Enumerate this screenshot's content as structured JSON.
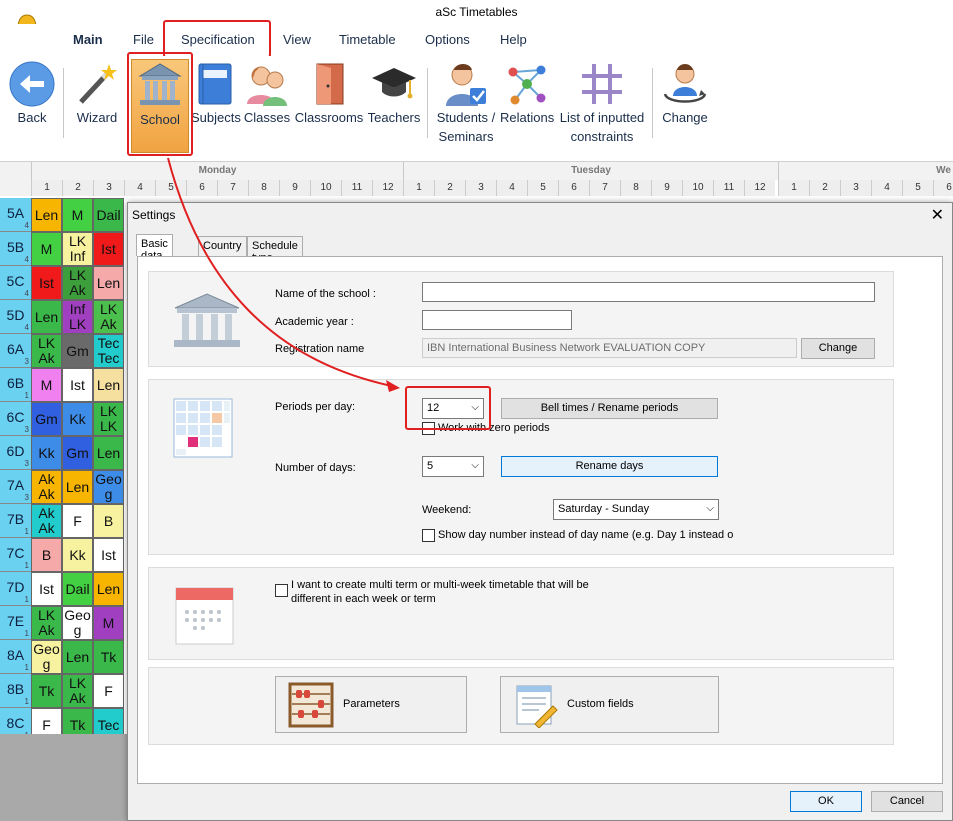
{
  "window": {
    "title": "aSc Timetables"
  },
  "menu": {
    "items": [
      "Main",
      "File",
      "Specification",
      "View",
      "Timetable",
      "Options",
      "Help"
    ]
  },
  "ribbon": {
    "back": "Back",
    "wizard": "Wizard",
    "school": "School",
    "subjects": "Subjects",
    "classes": "Classes",
    "classrooms": "Classrooms",
    "teachers": "Teachers",
    "students_l1": "Students /",
    "students_l2": "Seminars",
    "relations": "Relations",
    "constraints_l1": "List of inputted",
    "constraints_l2": "constraints",
    "change": "Change"
  },
  "grid": {
    "days": [
      "Monday",
      "Tuesday",
      "We"
    ],
    "periods": [
      "1",
      "2",
      "3",
      "4",
      "5",
      "6",
      "7",
      "8",
      "9",
      "10",
      "11",
      "12"
    ],
    "rows": [
      {
        "name": "5A",
        "sub": "4",
        "cells": [
          {
            "t": "Len",
            "c": "#f7b500"
          },
          {
            "t": "M",
            "c": "#43d143"
          },
          {
            "t": "Dail",
            "c": "#3bb84a"
          }
        ]
      },
      {
        "name": "5B",
        "sub": "4",
        "cells": [
          {
            "t": "M",
            "c": "#43d143"
          },
          {
            "t": "LK Inf",
            "c": "#f6f2a0"
          },
          {
            "t": "Ist",
            "c": "#f01a1a"
          }
        ]
      },
      {
        "name": "5C",
        "sub": "4",
        "cells": [
          {
            "t": "Ist",
            "c": "#f01a1a"
          },
          {
            "t": "LK Ak",
            "c": "#3c9f3c"
          },
          {
            "t": "Len",
            "c": "#f5a9a9"
          }
        ]
      },
      {
        "name": "5D",
        "sub": "4",
        "cells": [
          {
            "t": "Len",
            "c": "#3bb84a"
          },
          {
            "t": "Inf LK",
            "c": "#a040c0"
          },
          {
            "t": "LK Ak",
            "c": "#4cc04c"
          }
        ]
      },
      {
        "name": "6A",
        "sub": "3",
        "cells": [
          {
            "t": "LK Ak",
            "c": "#3bb84a"
          },
          {
            "t": "Gm",
            "c": "#6a6a6a"
          },
          {
            "t": "Tec Tec",
            "c": "#22cccc"
          }
        ]
      },
      {
        "name": "6B",
        "sub": "1",
        "cells": [
          {
            "t": "M",
            "c": "#f080f0"
          },
          {
            "t": "Ist",
            "c": "#ffffff"
          },
          {
            "t": "Len",
            "c": "#f5e0a0"
          }
        ]
      },
      {
        "name": "6C",
        "sub": "3",
        "cells": [
          {
            "t": "Gm",
            "c": "#3060e0"
          },
          {
            "t": "Kk",
            "c": "#3d8de8"
          },
          {
            "t": "LK LK",
            "c": "#3bb84a"
          }
        ]
      },
      {
        "name": "6D",
        "sub": "3",
        "cells": [
          {
            "t": "Kk",
            "c": "#3d8de8"
          },
          {
            "t": "Gm",
            "c": "#3060e0"
          },
          {
            "t": "Len",
            "c": "#3bb84a"
          }
        ]
      },
      {
        "name": "7A",
        "sub": "3",
        "cells": [
          {
            "t": "Ak Ak",
            "c": "#f7b500"
          },
          {
            "t": "Len",
            "c": "#f7b500"
          },
          {
            "t": "Geo g",
            "c": "#3d8de8"
          }
        ]
      },
      {
        "name": "7B",
        "sub": "1",
        "cells": [
          {
            "t": "Ak Ak",
            "c": "#22cccc"
          },
          {
            "t": "F",
            "c": "#ffffff"
          },
          {
            "t": "B",
            "c": "#f6f2a0"
          }
        ]
      },
      {
        "name": "7C",
        "sub": "1",
        "cells": [
          {
            "t": "B",
            "c": "#f5a9a9"
          },
          {
            "t": "Kk",
            "c": "#f6f2a0"
          },
          {
            "t": "Ist",
            "c": "#ffffff"
          }
        ]
      },
      {
        "name": "7D",
        "sub": "1",
        "cells": [
          {
            "t": "Ist",
            "c": "#ffffff"
          },
          {
            "t": "Dail",
            "c": "#43d143"
          },
          {
            "t": "Len",
            "c": "#f7b500"
          }
        ]
      },
      {
        "name": "7E",
        "sub": "1",
        "cells": [
          {
            "t": "LK Ak",
            "c": "#3bb84a"
          },
          {
            "t": "Geo g",
            "c": "#ffffff"
          },
          {
            "t": "M",
            "c": "#a040c0"
          }
        ]
      },
      {
        "name": "8A",
        "sub": "1",
        "cells": [
          {
            "t": "Geo g",
            "c": "#f6f2a0"
          },
          {
            "t": "Len",
            "c": "#3bb84a"
          },
          {
            "t": "Tk",
            "c": "#3bb84a"
          }
        ]
      },
      {
        "name": "8B",
        "sub": "1",
        "cells": [
          {
            "t": "Tk",
            "c": "#3bb84a"
          },
          {
            "t": "LK Ak",
            "c": "#3bb84a"
          },
          {
            "t": "F",
            "c": "#ffffff"
          }
        ]
      },
      {
        "name": "8C",
        "sub": "1",
        "cells": [
          {
            "t": "F",
            "c": "#ffffff"
          },
          {
            "t": "Tk",
            "c": "#3bb84a"
          },
          {
            "t": "Tec",
            "c": "#22cccc"
          }
        ]
      }
    ]
  },
  "dialog": {
    "title": "Settings",
    "close": "✕",
    "tabs": [
      "Basic data",
      "Country",
      "Schedule type"
    ],
    "name_label": "Name of the school :",
    "name_value": "",
    "year_label": "Academic year :",
    "year_value": "",
    "reg_label": "Registration name",
    "reg_value": "IBN International Business Network EVALUATION COPY",
    "change_btn": "Change",
    "periods_label": "Periods per day:",
    "periods_value": "12",
    "bell_btn": "Bell times / Rename periods",
    "zero_label": "Work with zero periods",
    "days_label": "Number of days:",
    "days_value": "5",
    "rename_btn": "Rename days",
    "weekend_label": "Weekend:",
    "weekend_value": "Saturday - Sunday",
    "daynum_label": "Show day number instead of day name (e.g. Day 1 instead o",
    "multi_l1": "I want to create multi term or multi-week timetable that will be",
    "multi_l2": "different in each week or term",
    "params_btn": "Parameters",
    "custom_btn": "Custom fields",
    "ok": "OK",
    "cancel": "Cancel"
  }
}
